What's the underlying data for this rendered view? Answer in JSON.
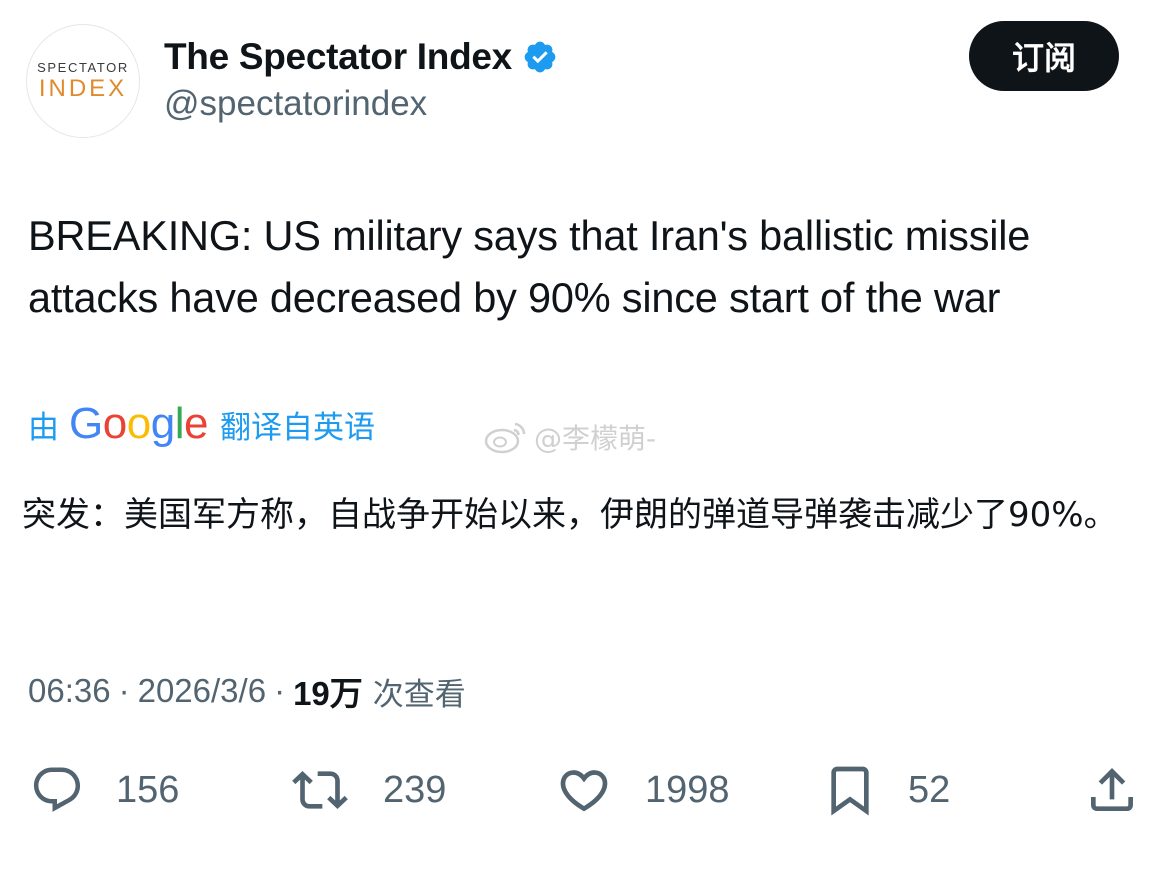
{
  "header": {
    "avatar_logo_top": "SPECTATOR",
    "avatar_logo_bottom": "INDEX",
    "display_name": "The Spectator Index",
    "handle": "@spectatorindex",
    "verified_icon": "verified-badge-icon",
    "subscribe_label": "订阅"
  },
  "tweet": {
    "text": "BREAKING: US military says that Iran's ballistic missile attacks have decreased by 90% since start of the war",
    "translate_prefix": "由",
    "translate_brand": "Google",
    "translate_suffix": "翻译自英语",
    "translated_text": "突发：美国军方称，自战争开始以来，伊朗的弹道导弹袭击减少了90%。"
  },
  "watermark": {
    "text": "@李檬萌-",
    "icon": "weibo-icon"
  },
  "meta": {
    "time": "06:36",
    "date": "2026/3/6",
    "views_count": "19万",
    "views_label": "次查看"
  },
  "actions": {
    "reply_count": "156",
    "repost_count": "239",
    "like_count": "1998",
    "bookmark_count": "52"
  },
  "colors": {
    "accent": "#1d9bf0",
    "text": "#0f1419",
    "secondary": "#536471",
    "logo_orange": "#e08a2c"
  }
}
